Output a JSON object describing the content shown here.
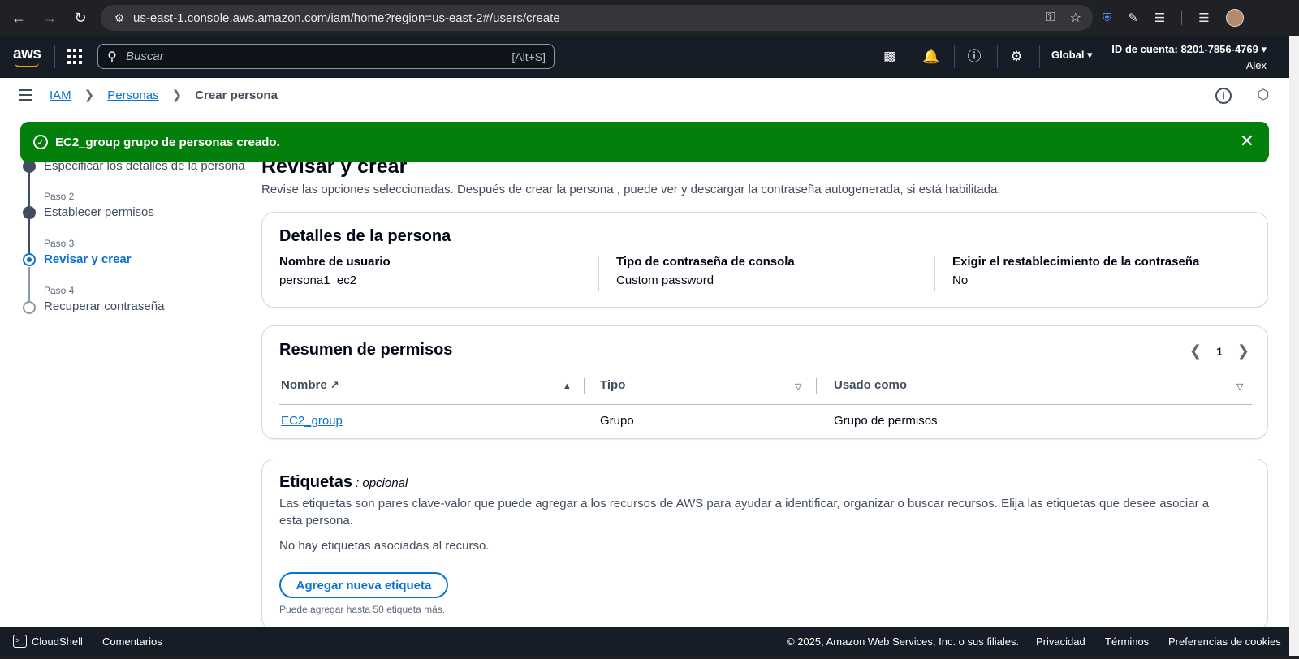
{
  "browser": {
    "url": "us-east-1.console.aws.amazon.com/iam/home?region=us-east-2#/users/create"
  },
  "awsnav": {
    "logo": "aws",
    "search_placeholder": "Buscar",
    "search_shortcut": "[Alt+S]",
    "region": "Global ▾",
    "account_id": "ID de cuenta: 8201-7856-4769 ▾",
    "user": "Alex"
  },
  "breadcrumb": {
    "iam": "IAM",
    "personas": "Personas",
    "current": "Crear persona"
  },
  "flash": {
    "message": "EC2_group grupo de personas creado."
  },
  "steps": [
    {
      "num": "",
      "label": "Especificar los detalles de la persona",
      "state": "done"
    },
    {
      "num": "Paso 2",
      "label": "Establecer permisos",
      "state": "done"
    },
    {
      "num": "Paso 3",
      "label": "Revisar y crear",
      "state": "active"
    },
    {
      "num": "Paso 4",
      "label": "Recuperar contraseña",
      "state": "todo"
    }
  ],
  "main": {
    "title": "Revisar y crear",
    "description": "Revise las opciones seleccionadas. Después de crear la persona , puede ver y descargar la contraseña autogenerada, si está habilitada."
  },
  "user_details": {
    "title": "Detalles de la persona",
    "fields": [
      {
        "label": "Nombre de usuario",
        "value": "persona1_ec2"
      },
      {
        "label": "Tipo de contraseña de consola",
        "value": "Custom password"
      },
      {
        "label": "Exigir el restablecimiento de la contraseña",
        "value": "No"
      }
    ]
  },
  "permissions": {
    "title": "Resumen de permisos",
    "page": "1",
    "columns": [
      "Nombre",
      "Tipo",
      "Usado como"
    ],
    "rows": [
      {
        "name": "EC2_group",
        "type": "Grupo",
        "used_as": "Grupo de permisos"
      }
    ]
  },
  "tags": {
    "title": "Etiquetas",
    "optional": ": opcional",
    "description": "Las etiquetas son pares clave-valor que puede agregar a los recursos de AWS para ayudar a identificar, organizar o buscar recursos. Elija las etiquetas que desee asociar a esta persona.",
    "empty": "No hay etiquetas asociadas al recurso.",
    "add_button": "Agregar nueva etiqueta",
    "hint": "Puede agregar hasta 50 etiqueta más."
  },
  "footer": {
    "cloudshell": "CloudShell",
    "comments": "Comentarios",
    "copyright": "© 2025, Amazon Web Services, Inc. o sus filiales.",
    "privacy": "Privacidad",
    "terms": "Términos",
    "cookies": "Preferencias de cookies"
  },
  "colors": {
    "success": "#037f0c",
    "link": "#0972d3",
    "nav_bg": "#161d26",
    "accent": "#ff9900"
  }
}
